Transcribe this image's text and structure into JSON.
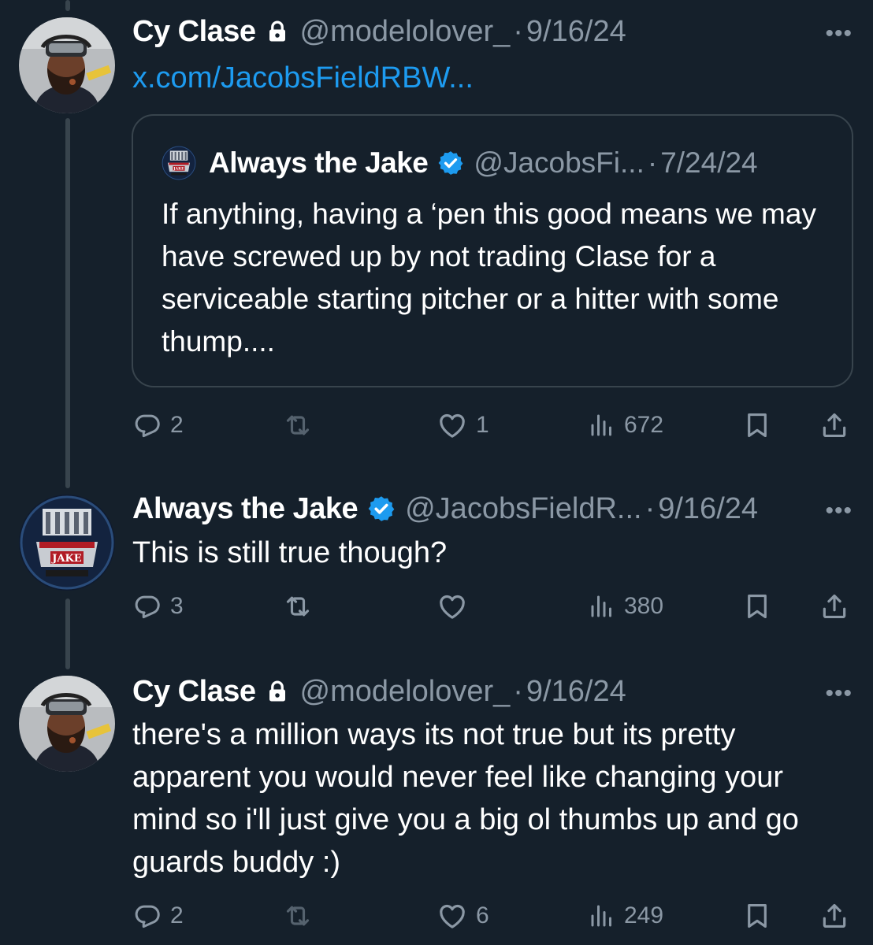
{
  "colors": {
    "background": "#15202b",
    "secondary_text": "#8b98a5",
    "link": "#1d9bf0",
    "verified": "#1d9bf0",
    "border": "#38444d"
  },
  "tweets": [
    {
      "author": "Cy Clase",
      "handle": "@modelolover_",
      "date": "9/16/24",
      "locked": true,
      "avatar": "cy-clase-avatar",
      "link_text": "x.com/JacobsFieldRBW...",
      "quote": {
        "author": "Always the Jake",
        "handle": "@JacobsFi...",
        "date": "7/24/24",
        "verified": true,
        "text": "If anything, having a ‘pen this good means we may have screwed up by not trading Clase for a serviceable starting pitcher or a hitter with some thump...."
      },
      "replies": "2",
      "reposts": "",
      "likes": "1",
      "views": "672"
    },
    {
      "author": "Always the Jake",
      "handle": "@JacobsFieldR...",
      "date": "9/16/24",
      "verified": true,
      "avatar": "always-the-jake-avatar",
      "text": "This is still true though?",
      "replies": "3",
      "reposts": "",
      "likes": "",
      "views": "380"
    },
    {
      "author": "Cy Clase",
      "handle": "@modelolover_",
      "date": "9/16/24",
      "locked": true,
      "avatar": "cy-clase-avatar",
      "text": "there's a million ways its not true but its pretty apparent you would never feel like changing your mind so i'll just give you a big ol thumbs up and go guards buddy :)",
      "replies": "2",
      "reposts": "",
      "likes": "6",
      "views": "249"
    }
  ],
  "icons": {
    "more": "more-icon",
    "reply": "reply-icon",
    "repost": "repost-icon",
    "like": "like-icon",
    "views": "views-icon",
    "bookmark": "bookmark-icon",
    "share": "share-icon",
    "lock": "lock-icon",
    "verified": "verified-badge-icon"
  }
}
